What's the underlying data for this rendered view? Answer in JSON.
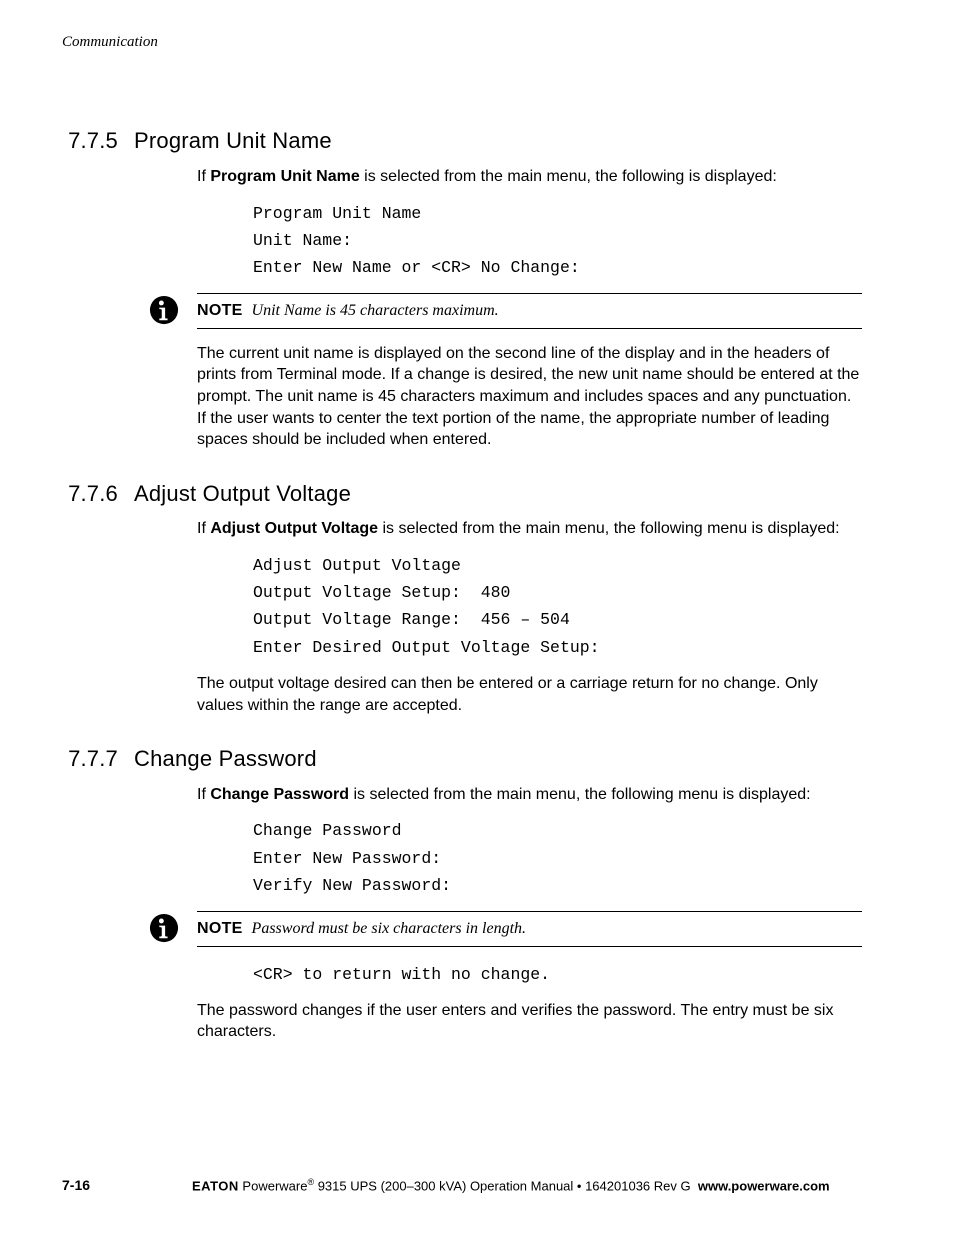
{
  "header": {
    "running": "Communication"
  },
  "sections": {
    "s1": {
      "num": "7.7.5",
      "title": "Program Unit Name",
      "intro_pre": "If ",
      "intro_bold": "Program Unit Name",
      "intro_post": " is selected from the main menu, the following is displayed:",
      "code": "Program Unit Name\nUnit Name:\nEnter New Name or <CR> No Change:",
      "note_label": "NOTE",
      "note_text": "Unit Name is 45 characters maximum.",
      "para": "The current unit name is displayed on the second line of the display and in the headers of prints from Terminal mode. If a change is desired, the new unit name should be entered at the prompt. The unit name is 45 characters maximum and includes spaces and any punctuation. If the user wants to center the text portion of the name, the appropriate number of leading spaces should be included when entered."
    },
    "s2": {
      "num": "7.7.6",
      "title": "Adjust Output Voltage",
      "intro_pre": "If ",
      "intro_bold": "Adjust Output Voltage",
      "intro_post": " is selected from the main menu, the following menu is displayed:",
      "code": "Adjust Output Voltage\nOutput Voltage Setup:  480\nOutput Voltage Range:  456 – 504\nEnter Desired Output Voltage Setup:",
      "para": "The output voltage desired can then be entered or a carriage return for no change. Only values within the range are accepted."
    },
    "s3": {
      "num": "7.7.7",
      "title": "Change Password",
      "intro_pre": "If ",
      "intro_bold": "Change Password",
      "intro_post": " is selected from the main menu, the following menu is displayed:",
      "code1": "Change Password\nEnter New Password:\nVerify New Password:",
      "note_label": "NOTE",
      "note_text": "Password must be six characters in length.",
      "code2": "<CR> to return with no change.",
      "para": "The password changes if the user enters and verifies the password. The entry must be six characters."
    }
  },
  "footer": {
    "page": "7-16",
    "brand": "EATON",
    "product_pre": " Powerware",
    "reg": "®",
    "product_post": " 9315 UPS (200–300 kVA) Operation Manual",
    "sep": "  •  ",
    "doc": "164201036 Rev G",
    "url": "www.powerware.com"
  }
}
